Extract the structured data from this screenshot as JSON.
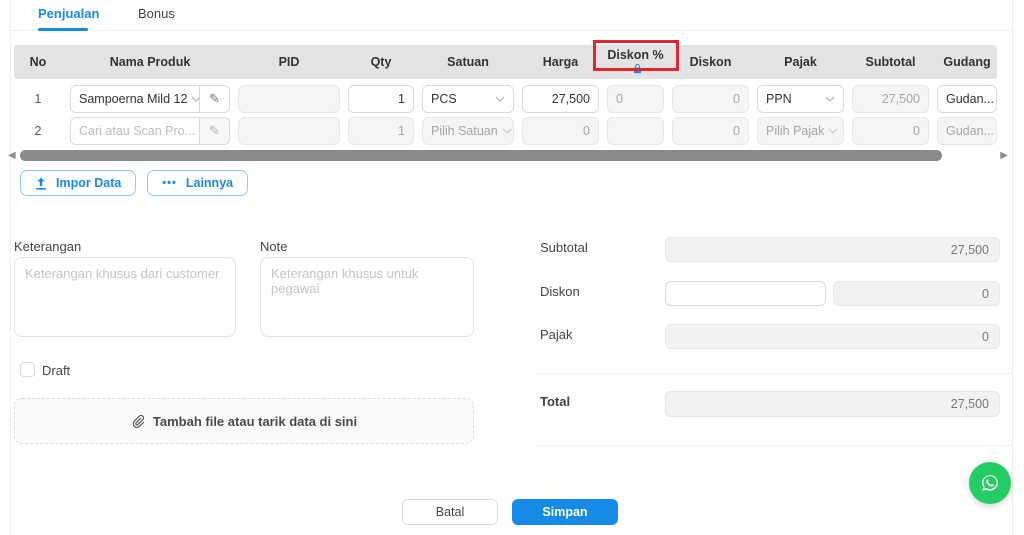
{
  "tabs": [
    {
      "label": "Penjualan",
      "active": true
    },
    {
      "label": "Bonus",
      "active": false
    }
  ],
  "table": {
    "headers": [
      "No",
      "Nama Produk",
      "PID",
      "Qty",
      "Satuan",
      "Harga",
      "Diskon %",
      "Diskon",
      "Pajak",
      "Subtotal",
      "Gudang"
    ],
    "rows": [
      {
        "no": "1",
        "product": "Sampoerna Mild 12",
        "pid": "",
        "qty": "1",
        "satuan": "PCS",
        "harga": "27,500",
        "diskon_pct": "0",
        "diskon": "0",
        "pajak": "PPN",
        "subtotal": "27,500",
        "gudang": "Gudan..."
      },
      {
        "no": "2",
        "product": "Cari atau Scan Pro...",
        "pid": "",
        "qty": "1",
        "satuan": "Pilih Satuan",
        "harga": "0",
        "diskon_pct": "",
        "diskon": "0",
        "pajak": "Pilih Pajak",
        "subtotal": "0",
        "gudang": "Gudan..."
      }
    ]
  },
  "toolbar": {
    "import_label": "Impor Data",
    "more_label": "Lainnya"
  },
  "notes": {
    "keterangan_label": "Keterangan",
    "keterangan_placeholder": "Keterangan khusus dari customer",
    "note_label": "Note",
    "note_placeholder": "Keterangan khusus untuk pegawai"
  },
  "summary": {
    "subtotal_label": "Subtotal",
    "subtotal_value": "27,500",
    "diskon_label": "Diskon",
    "diskon_input_value": "",
    "diskon_value": "0",
    "pajak_label": "Pajak",
    "pajak_value": "0",
    "total_label": "Total",
    "total_value": "27,500"
  },
  "draft_label": "Draft",
  "dropzone_label": "Tambah file atau tarik data di sini",
  "footer": {
    "cancel_label": "Batal",
    "save_label": "Simpan"
  },
  "icons": {
    "pencil_glyph": "✎",
    "ellipsis_glyph": "•••",
    "scroll_left_glyph": "◀",
    "scroll_right_glyph": "▶"
  },
  "colors": {
    "accent": "#1789e6",
    "annotation_red": "#e3242b",
    "whatsapp_green": "#25cc64",
    "header_gray": "#e3e3e3"
  }
}
